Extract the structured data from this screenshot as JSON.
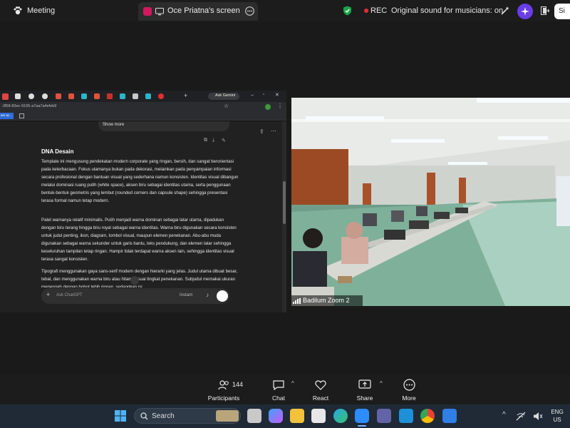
{
  "topbar": {
    "meeting_label": "Meeting",
    "share_title": "Oce Priatna's screen",
    "rec_label": "REC",
    "audio_label": "Original sound for musicians: on",
    "signin_label": "Si"
  },
  "shared_screen": {
    "ask_gemini": "Ask Gemini",
    "url_fragment": "-3f58-83ec-9165-a7aa7a4efeb9",
    "bookmark_fragment": "ars ac...",
    "show_more": "Show more",
    "heading": "DNA Desain",
    "paragraphs": [
      "Template ini mengusung pendekatan modern corporate yang ringan, bersih, dan sangat berorientasi pada keterbacaan. Fokus utamanya bukan pada dekorasi, melainkan pada penyampaian informasi secara profesional dengan bantuan visual yang sederhana namun konsisten. Identitas visual dibangun melalui dominasi ruang putih (white space), aksen biru sebagai identitas utama, serta penggunaan bentuk-bentuk geometris yang lembut (rounded corners dan capsule shape) sehingga presentasi terasa formal namun tetap modern.",
      "Palet warnanya relatif minimalis. Putih menjadi warna dominan sebagai latar utama, dipadukan dengan biru terang hingga biru royal sebagai warna identitas. Warna biru digunakan secara konsisten untuk judul penting, ikon, diagram, tombol visual, maupun elemen penekanan. Abu-abu muda digunakan sebagai warna sekunder untuk garis bantu, teks pendukung, dan elemen latar sehingga keseluruhan tampilan tetap ringan. Hampir tidak terdapat warna aksen lain, sehingga identitas visual terasa sangat konsisten.",
      "Tipografi menggunakan gaya sans-serif modern dengan hierarki yang jelas. Judul utama dibuat besar, tebal, dan menggunakan warna biru atau hitam sesuai tingkat penekanan. Subjudul memakai ukuran menengah dengan bobot lebih ringan, sedangkan isi"
    ],
    "composer_placeholder": "Ask ChatGPT",
    "composer_mode": "Instant"
  },
  "camera": {
    "name_label": "Badilum Zoom 2"
  },
  "controls": {
    "participants_count": "144",
    "participants_label": "Participants",
    "chat_label": "Chat",
    "react_label": "React",
    "share_label": "Share",
    "more_label": "More"
  },
  "taskbar": {
    "search_placeholder": "Search",
    "lang_line1": "ENG",
    "lang_line2": "US"
  },
  "colors": {
    "zoom_bg": "#1c1c1c",
    "rec_dot": "#e02f2f",
    "shield_green": "#1aa34a",
    "ai_purple": "#6a3de8",
    "taskbar": "#1f2a36"
  }
}
